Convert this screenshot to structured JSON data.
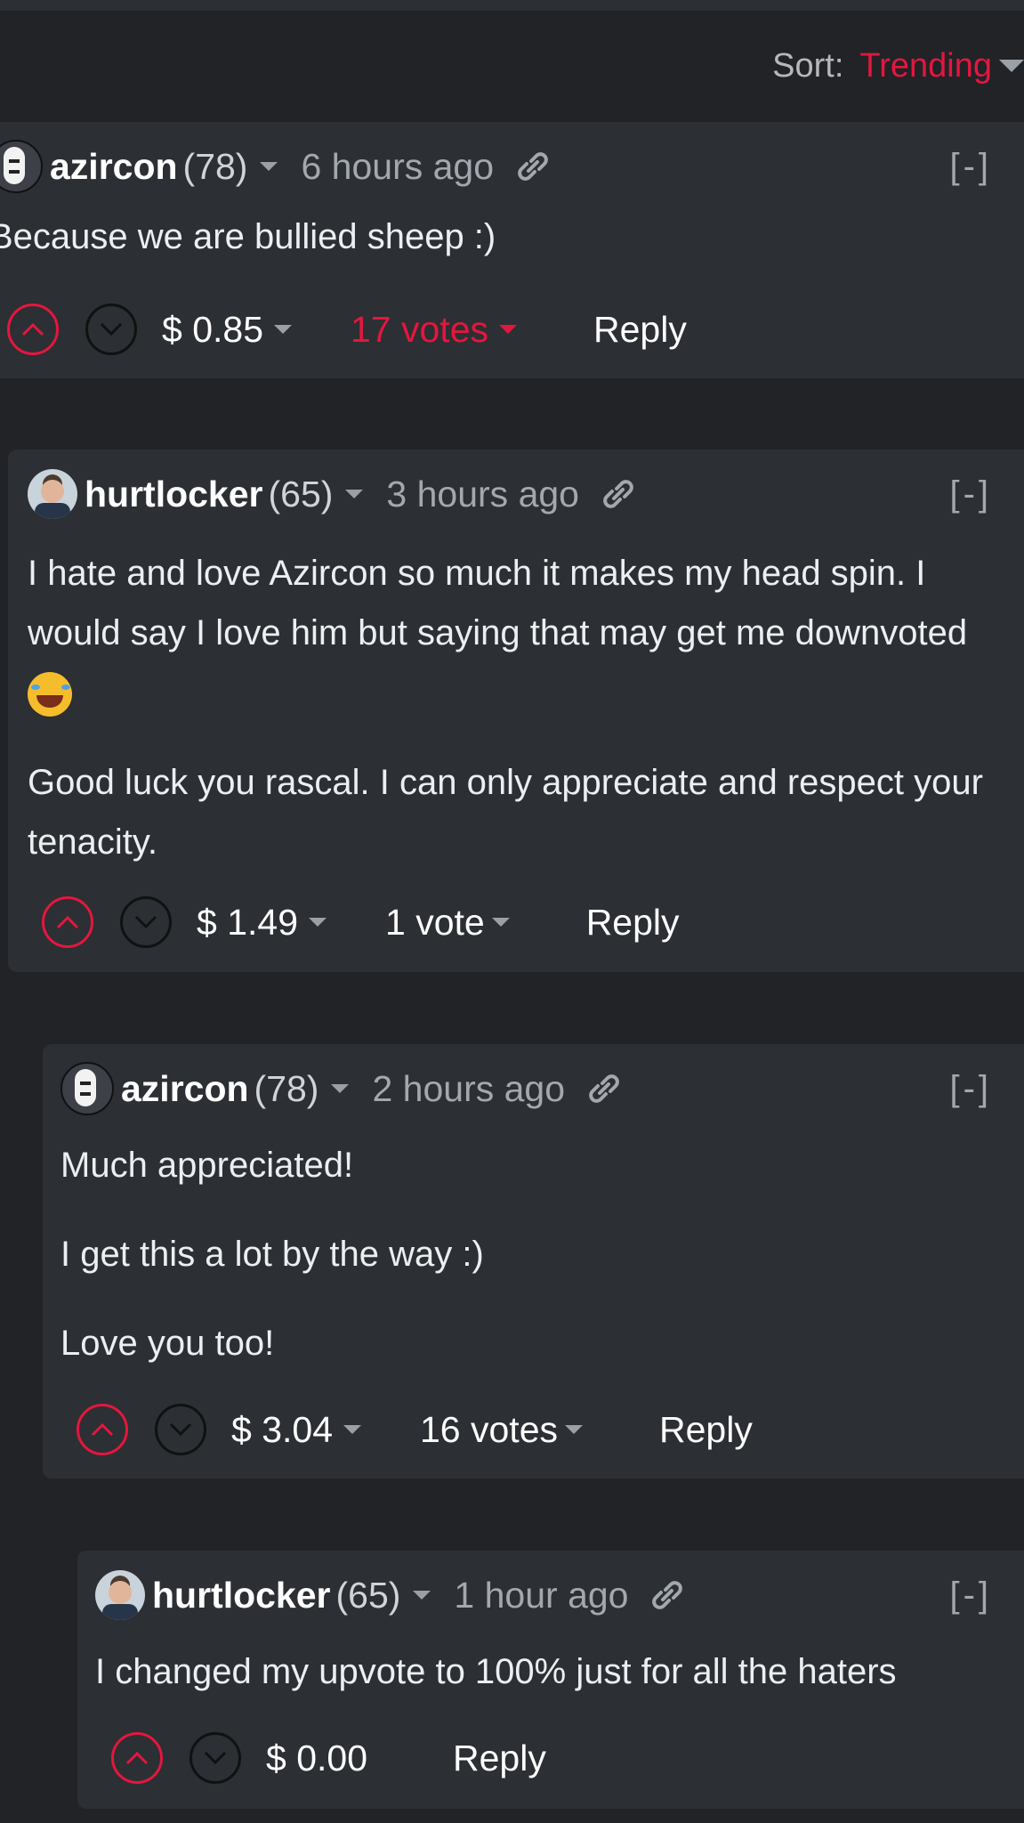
{
  "sort": {
    "label": "Sort:",
    "value": "Trending"
  },
  "colors": {
    "accent": "#e3173e",
    "panel": "#2c2f33",
    "background": "#212327"
  },
  "comments": [
    {
      "author": "azircon",
      "reputation": "(78)",
      "time": "6 hours ago",
      "collapse": "[-]",
      "avatar": "no-face-avatar",
      "body": [
        "Because we are bullied sheep :)"
      ],
      "payout": "$ 0.85",
      "votes": "17 votes",
      "reply": "Reply"
    },
    {
      "author": "hurtlocker",
      "reputation": "(65)",
      "time": "3 hours ago",
      "collapse": "[-]",
      "avatar": "man-with-glasses-avatar",
      "body": [
        "I hate and love Azircon so much it makes my head spin. I would say I love him but saying that may get me downvoted",
        "Good luck you rascal. I can only appreciate and respect your tenacity."
      ],
      "emoji": "rolling-on-floor-laughing-emoji",
      "payout": "$ 1.49",
      "votes": "1 vote",
      "reply": "Reply"
    },
    {
      "author": "azircon",
      "reputation": "(78)",
      "time": "2 hours ago",
      "collapse": "[-]",
      "avatar": "no-face-avatar",
      "body": [
        "Much appreciated!",
        "I get this a lot by the way :)",
        "Love you too!"
      ],
      "payout": "$ 3.04",
      "votes": "16 votes",
      "reply": "Reply"
    },
    {
      "author": "hurtlocker",
      "reputation": "(65)",
      "time": "1 hour ago",
      "collapse": "[-]",
      "avatar": "man-with-glasses-avatar",
      "body": [
        "I changed my upvote to 100% just for all the haters"
      ],
      "payout": "$ 0.00",
      "reply": "Reply"
    }
  ]
}
